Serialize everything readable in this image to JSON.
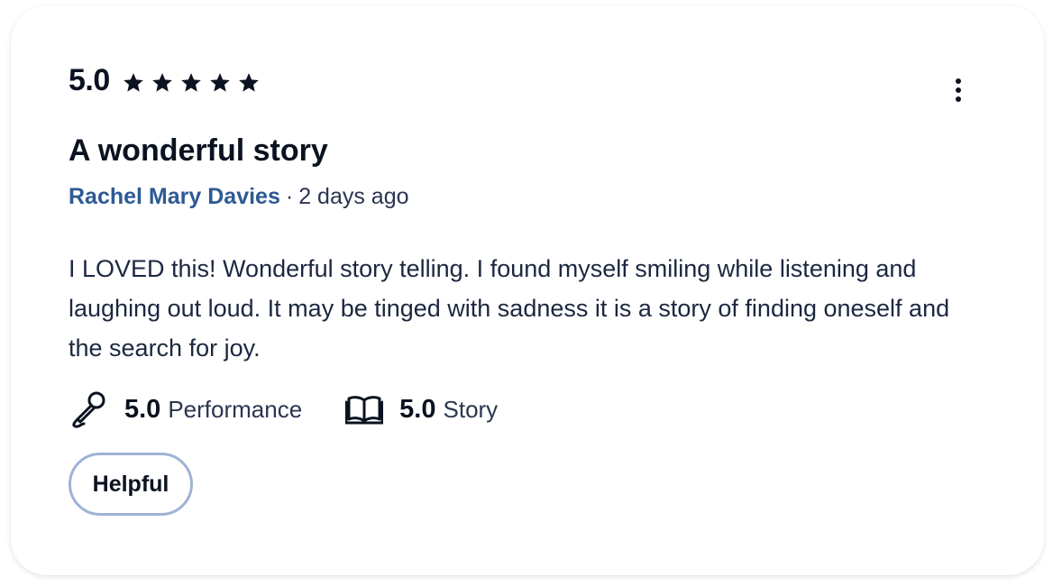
{
  "review": {
    "overall_score": "5.0",
    "star_rating": 5,
    "star_max": 5,
    "title": "A wonderful story",
    "author": "Rachel Mary Davies",
    "separator": "·",
    "posted": "2 days ago",
    "body": "I LOVED this! Wonderful story telling. I found myself smiling while listening and laughing out loud. It may be tinged with sadness it is a story of finding oneself and the search for joy.",
    "sub_ratings": [
      {
        "icon": "microphone-icon",
        "score": "5.0",
        "label": "Performance"
      },
      {
        "icon": "book-icon",
        "score": "5.0",
        "label": "Story"
      }
    ],
    "helpful_label": "Helpful",
    "more_menu_icon": "more-vertical-icon"
  },
  "colors": {
    "text_primary": "#0b1220",
    "author_link": "#2d5a94",
    "helpful_border": "#9eb3d4"
  }
}
